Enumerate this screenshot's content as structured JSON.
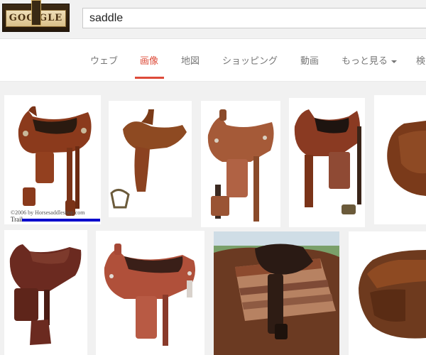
{
  "header": {
    "logo_text": "GOO GLE",
    "search_value": "saddle"
  },
  "tabs": [
    {
      "label": "ウェブ",
      "active": false
    },
    {
      "label": "画像",
      "active": true
    },
    {
      "label": "地図",
      "active": false
    },
    {
      "label": "ショッピング",
      "active": false
    },
    {
      "label": "動画",
      "active": false
    },
    {
      "label": "もっと見る",
      "active": false,
      "has_caret": true
    },
    {
      "label": "検",
      "active": false
    }
  ],
  "colors": {
    "active_tab": "#dd4b39",
    "selection_bar": "#0000cc",
    "page_bg": "#f1f1f1"
  },
  "results": {
    "first": {
      "watermark": "©2006 by Horsesaddleshop.com",
      "label": "Trail"
    }
  }
}
